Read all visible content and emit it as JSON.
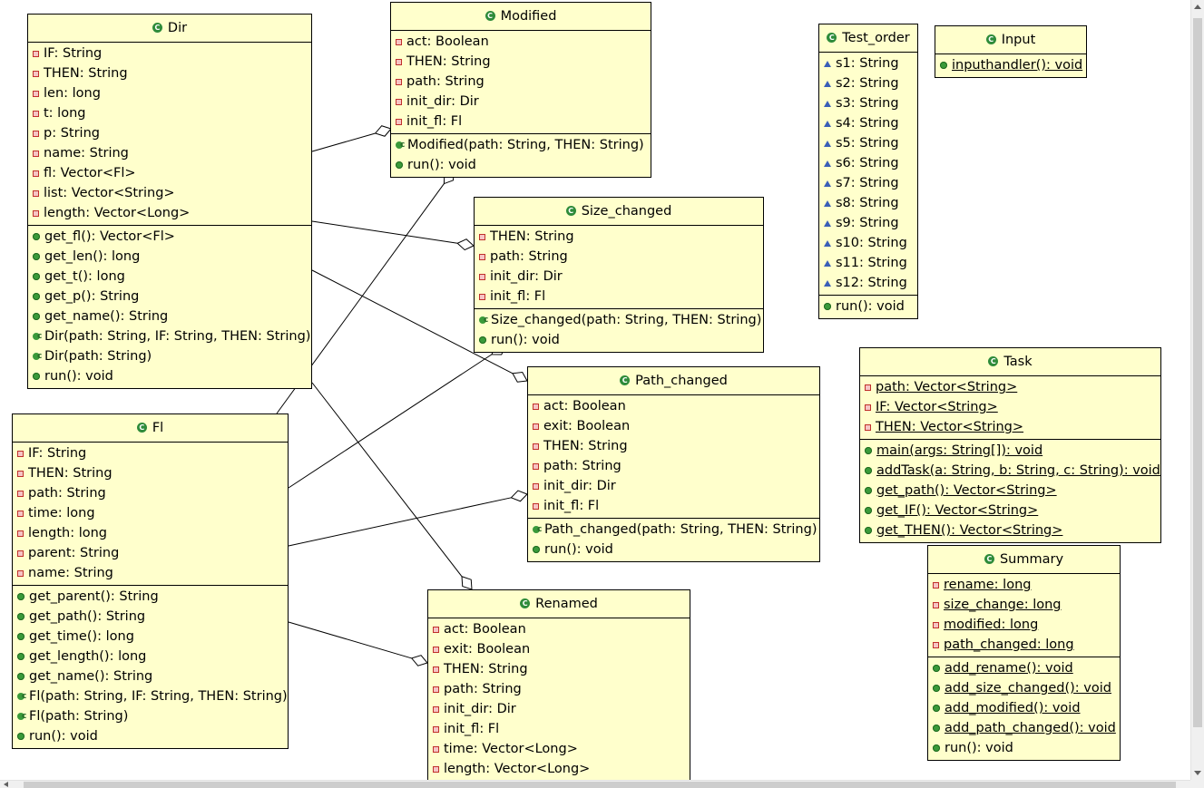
{
  "classes": [
    {
      "id": "dir",
      "name": "Dir",
      "attributes": [
        {
          "v": "private",
          "t": "IF: String"
        },
        {
          "v": "private",
          "t": "THEN: String"
        },
        {
          "v": "private",
          "t": "len: long"
        },
        {
          "v": "private",
          "t": "t: long"
        },
        {
          "v": "private",
          "t": "p: String"
        },
        {
          "v": "private",
          "t": "name: String"
        },
        {
          "v": "private",
          "t": "fl: Vector<Fl>"
        },
        {
          "v": "private",
          "t": "list: Vector<String>"
        },
        {
          "v": "private",
          "t": "length: Vector<Long>"
        }
      ],
      "operations": [
        {
          "v": "public",
          "t": "get_fl(): Vector<Fl>"
        },
        {
          "v": "public",
          "t": "get_len(): long"
        },
        {
          "v": "public",
          "t": "get_t(): long"
        },
        {
          "v": "public",
          "t": "get_p(): String"
        },
        {
          "v": "public",
          "t": "get_name(): String"
        },
        {
          "v": "constructor",
          "t": "Dir(path: String, IF: String, THEN: String)"
        },
        {
          "v": "constructor",
          "t": "Dir(path: String)"
        },
        {
          "v": "public",
          "t": "run(): void"
        }
      ]
    },
    {
      "id": "modified",
      "name": "Modified",
      "attributes": [
        {
          "v": "private",
          "t": "act: Boolean"
        },
        {
          "v": "private",
          "t": "THEN: String"
        },
        {
          "v": "private",
          "t": "path: String"
        },
        {
          "v": "private",
          "t": "init_dir: Dir"
        },
        {
          "v": "private",
          "t": "init_fl: Fl"
        }
      ],
      "operations": [
        {
          "v": "constructor",
          "t": "Modified(path: String, THEN: String)"
        },
        {
          "v": "public",
          "t": "run(): void"
        }
      ]
    },
    {
      "id": "size_changed",
      "name": "Size_changed",
      "attributes": [
        {
          "v": "private",
          "t": "THEN: String"
        },
        {
          "v": "private",
          "t": "path: String"
        },
        {
          "v": "private",
          "t": "init_dir: Dir"
        },
        {
          "v": "private",
          "t": "init_fl: Fl"
        }
      ],
      "operations": [
        {
          "v": "constructor",
          "t": "Size_changed(path: String, THEN: String)"
        },
        {
          "v": "public",
          "t": "run(): void"
        }
      ]
    },
    {
      "id": "path_changed",
      "name": "Path_changed",
      "attributes": [
        {
          "v": "private",
          "t": "act: Boolean"
        },
        {
          "v": "private",
          "t": "exit: Boolean"
        },
        {
          "v": "private",
          "t": "THEN: String"
        },
        {
          "v": "private",
          "t": "path: String"
        },
        {
          "v": "private",
          "t": "init_dir: Dir"
        },
        {
          "v": "private",
          "t": "init_fl: Fl"
        }
      ],
      "operations": [
        {
          "v": "constructor",
          "t": "Path_changed(path: String, THEN: String)"
        },
        {
          "v": "public",
          "t": "run(): void"
        }
      ]
    },
    {
      "id": "fl",
      "name": "Fl",
      "attributes": [
        {
          "v": "private",
          "t": "IF: String"
        },
        {
          "v": "private",
          "t": "THEN: String"
        },
        {
          "v": "private",
          "t": "path: String"
        },
        {
          "v": "private",
          "t": "time: long"
        },
        {
          "v": "private",
          "t": "length: long"
        },
        {
          "v": "private",
          "t": "parent: String"
        },
        {
          "v": "private",
          "t": "name: String"
        }
      ],
      "operations": [
        {
          "v": "public",
          "t": "get_parent(): String"
        },
        {
          "v": "public",
          "t": "get_path(): String"
        },
        {
          "v": "public",
          "t": "get_time(): long"
        },
        {
          "v": "public",
          "t": "get_length(): long"
        },
        {
          "v": "public",
          "t": "get_name(): String"
        },
        {
          "v": "constructor",
          "t": "Fl(path: String, IF: String, THEN: String)"
        },
        {
          "v": "constructor",
          "t": "Fl(path: String)"
        },
        {
          "v": "public",
          "t": "run(): void"
        }
      ]
    },
    {
      "id": "renamed",
      "name": "Renamed",
      "attributes": [
        {
          "v": "private",
          "t": "act: Boolean"
        },
        {
          "v": "private",
          "t": "exit: Boolean"
        },
        {
          "v": "private",
          "t": "THEN: String"
        },
        {
          "v": "private",
          "t": "path: String"
        },
        {
          "v": "private",
          "t": "init_dir: Dir"
        },
        {
          "v": "private",
          "t": "init_fl: Fl"
        },
        {
          "v": "private",
          "t": "time: Vector<Long>"
        },
        {
          "v": "private",
          "t": "length: Vector<Long>"
        }
      ],
      "operations": []
    },
    {
      "id": "test_order",
      "name": "Test_order",
      "attributes": [
        {
          "v": "package",
          "t": "s1: String"
        },
        {
          "v": "package",
          "t": "s2: String"
        },
        {
          "v": "package",
          "t": "s3: String"
        },
        {
          "v": "package",
          "t": "s4: String"
        },
        {
          "v": "package",
          "t": "s5: String"
        },
        {
          "v": "package",
          "t": "s6: String"
        },
        {
          "v": "package",
          "t": "s7: String"
        },
        {
          "v": "package",
          "t": "s8: String"
        },
        {
          "v": "package",
          "t": "s9: String"
        },
        {
          "v": "package",
          "t": "s10: String"
        },
        {
          "v": "package",
          "t": "s11: String"
        },
        {
          "v": "package",
          "t": "s12: String"
        }
      ],
      "operations": [
        {
          "v": "public",
          "t": "run(): void"
        }
      ]
    },
    {
      "id": "input",
      "name": "Input",
      "attributes": [],
      "operations": [
        {
          "v": "public",
          "t": "inputhandler(): void",
          "static": true
        }
      ]
    },
    {
      "id": "task",
      "name": "Task",
      "attributes": [
        {
          "v": "private",
          "t": "path: Vector<String>",
          "static": true
        },
        {
          "v": "private",
          "t": "IF: Vector<String>",
          "static": true
        },
        {
          "v": "private",
          "t": "THEN: Vector<String>",
          "static": true
        }
      ],
      "operations": [
        {
          "v": "public",
          "t": "main(args: String[]): void",
          "static": true
        },
        {
          "v": "public",
          "t": "addTask(a: String, b: String, c: String): void",
          "static": true
        },
        {
          "v": "public",
          "t": "get_path(): Vector<String>",
          "static": true
        },
        {
          "v": "public",
          "t": "get_IF(): Vector<String>",
          "static": true
        },
        {
          "v": "public",
          "t": "get_THEN(): Vector<String>",
          "static": true
        }
      ]
    },
    {
      "id": "summary",
      "name": "Summary",
      "attributes": [
        {
          "v": "private",
          "t": "rename: long",
          "static": true
        },
        {
          "v": "private",
          "t": "size_change: long",
          "static": true
        },
        {
          "v": "private",
          "t": "modified: long",
          "static": true
        },
        {
          "v": "private",
          "t": "path_changed: long",
          "static": true
        }
      ],
      "operations": [
        {
          "v": "public",
          "t": "add_rename(): void",
          "static": true
        },
        {
          "v": "public",
          "t": "add_size_changed(): void",
          "static": true
        },
        {
          "v": "public",
          "t": "add_modified(): void",
          "static": true
        },
        {
          "v": "public",
          "t": "add_path_changed(): void",
          "static": true
        },
        {
          "v": "public",
          "t": "run(): void"
        }
      ]
    }
  ],
  "associations": [
    {
      "from": "dir",
      "to": "modified",
      "end": "aggregation"
    },
    {
      "from": "dir",
      "to": "size_changed",
      "end": "aggregation"
    },
    {
      "from": "dir",
      "to": "path_changed",
      "end": "aggregation"
    },
    {
      "from": "dir",
      "to": "renamed",
      "end": "aggregation"
    },
    {
      "from": "fl",
      "to": "modified",
      "end": "aggregation"
    },
    {
      "from": "fl",
      "to": "size_changed",
      "end": "aggregation"
    },
    {
      "from": "fl",
      "to": "path_changed",
      "end": "aggregation"
    },
    {
      "from": "fl",
      "to": "renamed",
      "end": "aggregation"
    }
  ],
  "colors": {
    "class_fill": "#ffffcc",
    "line": "#000000",
    "private_icon": "#c0302c",
    "public_icon": "#3a9a3a",
    "package_icon": "#3a5fb8"
  }
}
